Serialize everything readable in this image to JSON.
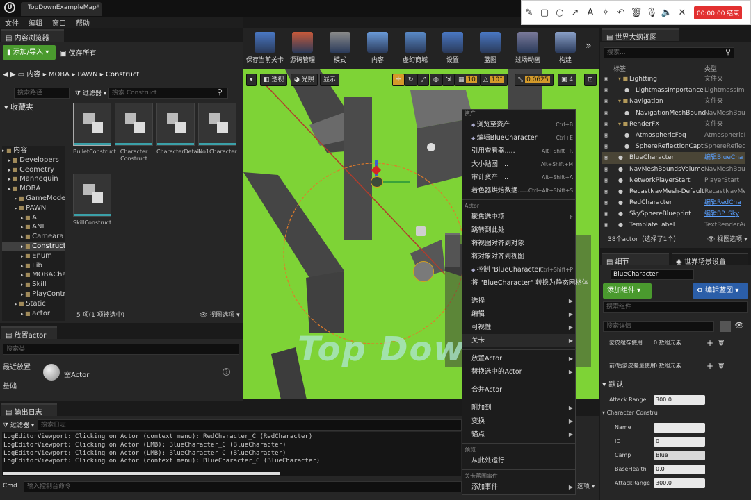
{
  "window": {
    "tab_title": "TopDownExampleMap*"
  },
  "menu": [
    "文件",
    "编辑",
    "窗口",
    "帮助"
  ],
  "recorder": {
    "timer": "00:00:00 结束",
    "colors": {
      "stop": "#e23030"
    }
  },
  "content_browser": {
    "tab": "内容浏览器",
    "add_import": "添加/导入",
    "save_all": "保存所有",
    "breadcrumb": [
      "内容",
      "MOBA",
      "PAWN",
      "Construct"
    ],
    "search_paths_placeholder": "搜索路径",
    "favorites": "收藏夹",
    "filter_label": "过滤器",
    "search_placeholder": "搜索 Construct",
    "tree": [
      {
        "label": "内容",
        "depth": 0
      },
      {
        "label": "Developers",
        "depth": 1
      },
      {
        "label": "Geometry",
        "depth": 1
      },
      {
        "label": "Mannequin",
        "depth": 1
      },
      {
        "label": "MOBA",
        "depth": 1
      },
      {
        "label": "GameMode",
        "depth": 2
      },
      {
        "label": "PAWN",
        "depth": 2
      },
      {
        "label": "AI",
        "depth": 3
      },
      {
        "label": "ANI",
        "depth": 3
      },
      {
        "label": "Cameara",
        "depth": 3
      },
      {
        "label": "Construct",
        "depth": 3,
        "selected": true
      },
      {
        "label": "Enum",
        "depth": 3
      },
      {
        "label": "Lib",
        "depth": 3
      },
      {
        "label": "MOBACha",
        "depth": 3
      },
      {
        "label": "Skill",
        "depth": 3
      },
      {
        "label": "PlayContro",
        "depth": 3
      },
      {
        "label": "Static",
        "depth": 2
      },
      {
        "label": "actor",
        "depth": 3
      }
    ],
    "assets": [
      "BulletConstruct",
      "Character Construct",
      "CharacterDetail",
      "No1Character",
      "SkillConstruct"
    ],
    "status": "5 项(1 项被选中)",
    "view_options": "视图选项"
  },
  "place_actor": {
    "tab": "放置actor",
    "search_placeholder": "搜索类",
    "categories": [
      "最近放置",
      "基础"
    ],
    "item": "空Actor"
  },
  "output_log": {
    "tab": "输出日志",
    "filter": "过滤器",
    "search_placeholder": "搜索日志",
    "lines": [
      "LogEditorViewport: Clicking on Actor (context menu): RedCharacter_C (RedCharacter)",
      "LogEditorViewport: Clicking on Actor (LMB): BlueCharacter_C (BlueCharacter)",
      "LogEditorViewport: Clicking on Actor (LMB): BlueCharacter_C (BlueCharacter)",
      "LogEditorViewport: Clicking on Actor (context menu): BlueCharacter_C (BlueCharacter)"
    ],
    "cmd_label": "Cmd",
    "cmd_placeholder": "输入控制台命令",
    "view_options": "选项"
  },
  "toolbar": [
    "保存当前关卡",
    "源码管理",
    "模式",
    "内容",
    "虚幻商城",
    "设置",
    "蓝图",
    "过场动画",
    "构建"
  ],
  "viewport": {
    "perspective": "透视",
    "lit": "光照",
    "show": "显示",
    "grid_snap": "10",
    "rot_snap": "10°",
    "scale_snap": "0.0625",
    "camera_speed": "4",
    "watermark": "Top Down"
  },
  "context_menu": {
    "sections": [
      {
        "title": "资产",
        "items": [
          {
            "label": "浏览至资产",
            "shortcut": "Ctrl+B",
            "icon": true
          },
          {
            "label": "编辑BlueCharacter",
            "shortcut": "Ctrl+E",
            "icon": true
          },
          {
            "label": "引用查看器.....",
            "shortcut": "Alt+Shift+R"
          },
          {
            "label": "大小贴图.....",
            "shortcut": "Alt+Shift+M"
          },
          {
            "label": "审计资产.....",
            "shortcut": "Alt+Shift+A"
          },
          {
            "label": "着色器烘焙数据.....",
            "shortcut": "Ctrl+Alt+Shift+S"
          }
        ]
      },
      {
        "title": "Actor",
        "items": [
          {
            "label": "聚焦选中项",
            "shortcut": "F"
          },
          {
            "label": "跳转到此处",
            "shortcut": ""
          },
          {
            "label": "将视图对齐到对象",
            "shortcut": ""
          },
          {
            "label": "将对象对齐到视图",
            "shortcut": ""
          },
          {
            "label": "控制 'BlueCharacter'",
            "shortcut": "Ctrl+Shift+P",
            "icon": true
          },
          {
            "label": "将 \"BlueCharacter\" 转换为静态网格体",
            "shortcut": ""
          }
        ]
      },
      {
        "title": "",
        "items": [
          {
            "label": "选择",
            "arrow": true
          },
          {
            "label": "编辑",
            "arrow": true
          },
          {
            "label": "可视性",
            "arrow": true
          },
          {
            "label": "关卡",
            "arrow": true,
            "selected": true
          }
        ]
      },
      {
        "title": "",
        "items": [
          {
            "label": "放置Actor",
            "arrow": true
          },
          {
            "label": "替换选中的Actor",
            "arrow": true
          }
        ]
      },
      {
        "title": "",
        "items": [
          {
            "label": "合并Actor",
            "arrow": false
          }
        ]
      },
      {
        "title": "",
        "items": [
          {
            "label": "附加到",
            "arrow": true
          },
          {
            "label": "变换",
            "arrow": true
          },
          {
            "label": "锚点",
            "arrow": true
          }
        ]
      },
      {
        "title": "预览",
        "items": [
          {
            "label": "从此处运行",
            "shortcut": ""
          }
        ]
      },
      {
        "title": "关卡蓝图事件",
        "items": [
          {
            "label": "添加事件",
            "arrow": true
          }
        ]
      }
    ]
  },
  "outliner": {
    "tab": "世界大纲视图",
    "search_placeholder": "搜索...",
    "col_label": "标签",
    "col_type": "类型",
    "rows": [
      {
        "label": "Lightting",
        "type": "文件夹",
        "indent": 1,
        "folder": true
      },
      {
        "label": "LightmassImportance",
        "type": "LightmassImp",
        "indent": 2
      },
      {
        "label": "Navigation",
        "type": "文件夹",
        "indent": 1,
        "folder": true
      },
      {
        "label": "NavigationMeshBound",
        "type": "NavMeshBou",
        "indent": 2
      },
      {
        "label": "RenderFX",
        "type": "文件夹",
        "indent": 1,
        "folder": true
      },
      {
        "label": "AtmosphericFog",
        "type": "AtmosphericFo",
        "indent": 2
      },
      {
        "label": "SphereReflectionCapt",
        "type": "SphereReflect",
        "indent": 2
      },
      {
        "label": "BlueCharacter",
        "type": "编辑BlueCha",
        "indent": 1,
        "selected": true,
        "link": true
      },
      {
        "label": "NavMeshBoundsVolume",
        "type": "NavMeshBou",
        "indent": 1
      },
      {
        "label": "NetworkPlayerStart",
        "type": "PlayerStart",
        "indent": 1
      },
      {
        "label": "RecastNavMesh-Default",
        "type": "RecastNavMe",
        "indent": 1
      },
      {
        "label": "RedCharacter",
        "type": "编辑RedCha",
        "indent": 1,
        "link": true
      },
      {
        "label": "SkySphereBlueprint",
        "type": "编辑BP_Sky",
        "indent": 1,
        "link": true
      },
      {
        "label": "TemplateLabel",
        "type": "TextRenderAc",
        "indent": 1
      }
    ],
    "status": "38个actor（选择了1个）",
    "view_options": "视图选项"
  },
  "details": {
    "tab": "细节",
    "world_settings_tab": "世界场景设置",
    "name": "BlueCharacter",
    "add_component": "添加组件",
    "edit_blueprint": "编辑蓝图",
    "search_components": "搜索组件",
    "search_details": "搜索详情",
    "misc_rows": [
      {
        "label": "蒙皮缓存使用",
        "value": "0 数组元素"
      },
      {
        "label": "前/后蒙皮差量使用",
        "value": "0 数组元素"
      }
    ],
    "default_section": "默认",
    "attack_range_label": "Attack Range",
    "attack_range_value": "300.0",
    "construct_section": "Character Constru",
    "props": [
      {
        "label": "Name",
        "value": ""
      },
      {
        "label": "ID",
        "value": "0"
      },
      {
        "label": "Camp",
        "value": "Blue"
      },
      {
        "label": "BaseHealth",
        "value": "0.0"
      },
      {
        "label": "AttackRange",
        "value": "300.0"
      }
    ]
  }
}
